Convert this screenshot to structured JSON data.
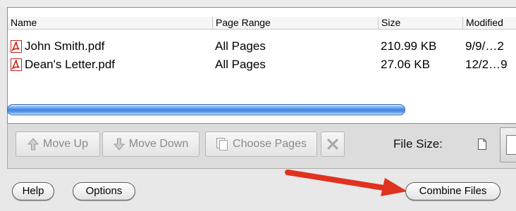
{
  "file_list": {
    "columns": [
      "Name",
      "Page Range",
      "Size",
      "Modified"
    ],
    "rows": [
      {
        "name": "John Smith.pdf",
        "page_range": "All Pages",
        "size": "210.99 KB",
        "modified": "9/9/…2"
      },
      {
        "name": "Dean's Letter.pdf",
        "page_range": "All Pages",
        "size": "27.06 KB",
        "modified": "12/2…9"
      }
    ]
  },
  "toolbar": {
    "move_up": "Move Up",
    "move_down": "Move Down",
    "choose_pages": "Choose Pages",
    "file_size_label": "File Size:"
  },
  "footer": {
    "help": "Help",
    "options": "Options",
    "combine": "Combine Files"
  },
  "colors": {
    "annotation_arrow": "#e0321f",
    "scrollbar": "#3f82dd",
    "pdf_icon": "#c8231b"
  },
  "icons": {
    "row_file": "pdf-file-icon",
    "move_up": "arrow-up-icon",
    "move_down": "arrow-down-icon",
    "choose_pages": "pages-icon",
    "delete": "close-x-icon",
    "small_file_size": "small-document-icon",
    "large_file_size": "large-document-icon"
  }
}
